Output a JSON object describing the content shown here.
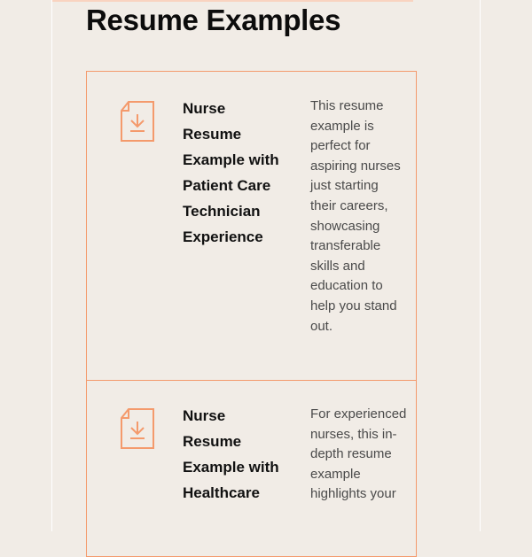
{
  "page": {
    "title": "Resume Examples"
  },
  "colors": {
    "accent": "#f49a6c",
    "background": "#f1ece6",
    "title_text": "#0c0c0c",
    "body_text": "#4a4a4a"
  },
  "examples": [
    {
      "icon": "download-document-icon",
      "title": "Nurse Resume Example with Patient Care Technician Experience",
      "description": "This resume example is perfect for aspiring nurses just starting their careers, showcasing transferable skills and education to help you stand out."
    },
    {
      "icon": "download-document-icon",
      "title": "Nurse Resume Example with Healthcare",
      "description": "For experienced nurses, this in-depth resume example highlights your"
    }
  ]
}
